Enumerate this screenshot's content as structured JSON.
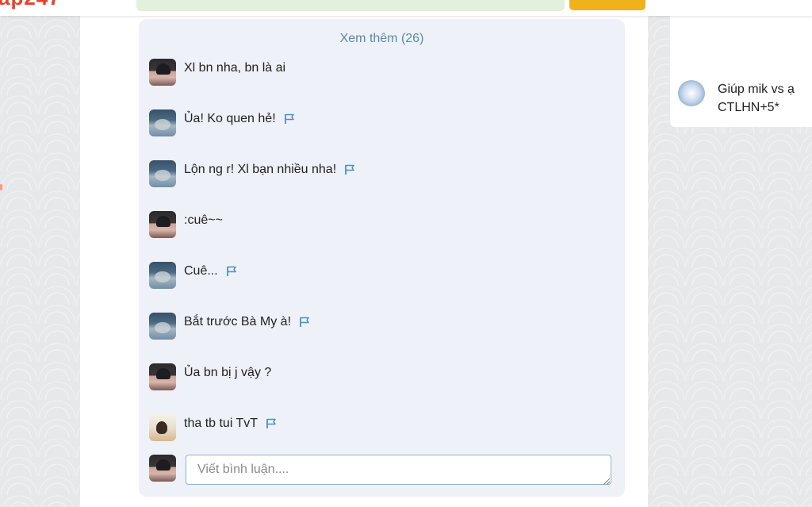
{
  "see_more": "Xem thêm (26)",
  "comments": [
    {
      "avatar": "boy-avatar",
      "text": "Xl bn nha, bn là ai",
      "flag": false
    },
    {
      "avatar": "girl-avatar",
      "text": "Ủa! Ko quen hẻ!",
      "flag": true
    },
    {
      "avatar": "girl-avatar",
      "text": "Lộn ng r! Xl bạn nhiều nha!",
      "flag": true
    },
    {
      "avatar": "boy-avatar",
      "text": ":cuê~~",
      "flag": false
    },
    {
      "avatar": "girl-avatar",
      "text": "Cuê...",
      "flag": true
    },
    {
      "avatar": "girl-avatar",
      "text": "Bắt trước Bà My à!",
      "flag": true
    },
    {
      "avatar": "boy-avatar",
      "text": "Ủa bn bị j vậy ?",
      "flag": false
    },
    {
      "avatar": "photo-avatar",
      "text": "tha tb tui TvT",
      "flag": true
    }
  ],
  "comment_input": {
    "placeholder": "Viết bình luận...."
  },
  "sidebar": {
    "question": "Giúp mik vs ạ CTLHN+5*"
  },
  "colors": {
    "accent": "#5b8aa4",
    "flag": "#4a90c2",
    "search_button": "#f0b21a",
    "logo": "#e8412c"
  }
}
